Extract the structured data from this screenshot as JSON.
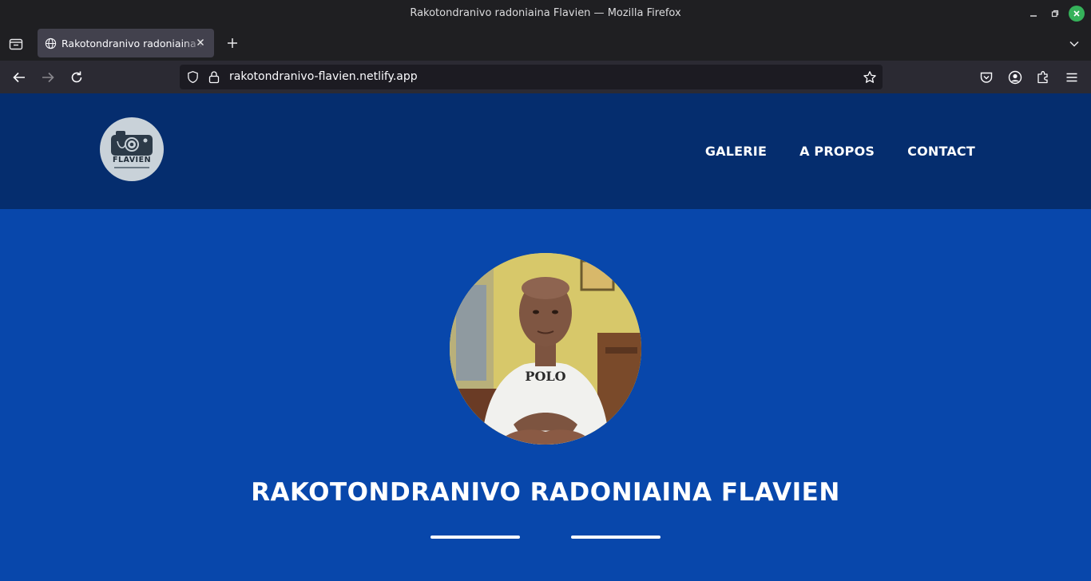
{
  "window": {
    "title": "Rakotondranivo radoniaina Flavien — Mozilla Firefox"
  },
  "tabs": [
    {
      "label": "Rakotondranivo radoniaina Flavien",
      "active": true
    }
  ],
  "toolbar": {
    "url": "rakotondranivo-flavien.netlify.app"
  },
  "site": {
    "logo_text": "FLAVIEN",
    "nav": [
      {
        "label": "GALERIE"
      },
      {
        "label": "A PROPOS"
      },
      {
        "label": "CONTACT"
      }
    ],
    "hero_name": "RAKOTONDRANIVO RADONIAINA FLAVIEN"
  },
  "colors": {
    "header_bg": "#052d6e",
    "hero_bg": "#0847ab",
    "chrome_bg": "#1f1f22",
    "accent_close": "#35b25a"
  },
  "icons": {
    "tab_list": "tab-list-icon",
    "globe": "globe-icon",
    "close": "close-icon",
    "new_tab": "plus-icon",
    "back": "arrow-left-icon",
    "forward": "arrow-right-icon",
    "reload": "reload-icon",
    "shield": "shield-icon",
    "lock": "lock-icon",
    "bookmark": "star-icon",
    "pocket": "pocket-icon",
    "account": "account-icon",
    "extensions": "puzzle-icon",
    "menu": "hamburger-menu-icon"
  }
}
